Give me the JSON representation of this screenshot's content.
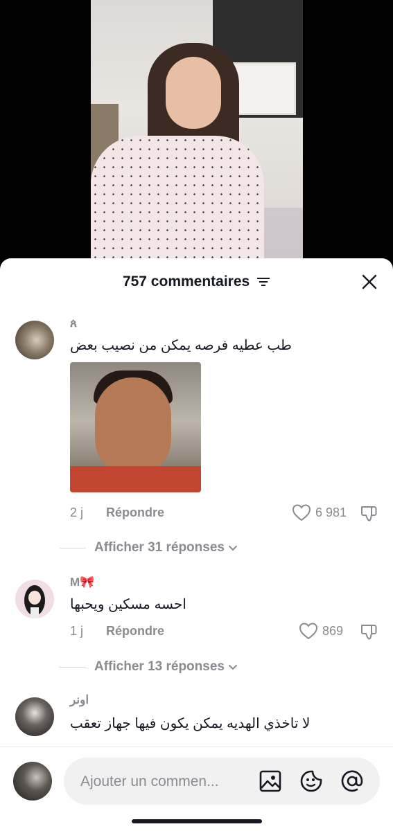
{
  "header": {
    "title": "757 commentaires"
  },
  "comments": [
    {
      "username": "ጰ",
      "text": "طب عطيه فرصه يمكن من نصيب بعض",
      "time": "2 j",
      "reply_label": "Répondre",
      "likes": "6 981",
      "show_replies": "Afficher 31 réponses"
    },
    {
      "username": "M🎀",
      "text": "احسه مسكين ويحبها",
      "time": "1 j",
      "reply_label": "Répondre",
      "likes": "869",
      "show_replies": "Afficher 13 réponses"
    },
    {
      "username": "اونر",
      "text": "لا تاخذي الهديه يمكن يكون فيها جهاز تعقب"
    }
  ],
  "input": {
    "placeholder": "Ajouter un commen..."
  },
  "colors": {
    "secondary_text": "#8a8b91",
    "primary_text": "#161823",
    "pill_bg": "#f1f1f2"
  }
}
